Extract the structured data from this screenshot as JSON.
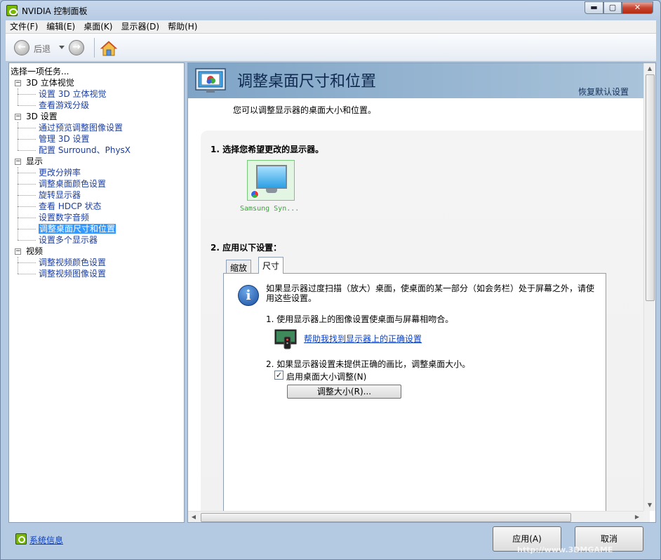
{
  "window": {
    "title": "NVIDIA 控制面板",
    "min_glyph": "▬",
    "max_glyph": "▢",
    "close_glyph": "✕"
  },
  "menu": [
    "文件(F)",
    "编辑(E)",
    "桌面(K)",
    "显示器(D)",
    "帮助(H)"
  ],
  "toolbar": {
    "back_label": "后退"
  },
  "left_panel": {
    "header": "选择一项任务...",
    "categories": [
      {
        "label": "3D 立体视觉",
        "items": [
          "设置 3D 立体视觉",
          "查看游戏分级"
        ]
      },
      {
        "label": "3D 设置",
        "items": [
          "通过预览调整图像设置",
          "管理 3D 设置",
          "配置 Surround、PhysX"
        ]
      },
      {
        "label": "显示",
        "items": [
          "更改分辨率",
          "调整桌面颜色设置",
          "旋转显示器",
          "查看 HDCP 状态",
          "设置数字音频",
          "调整桌面尺寸和位置",
          "设置多个显示器"
        ]
      },
      {
        "label": "视频",
        "items": [
          "调整视频颜色设置",
          "调整视频图像设置"
        ]
      }
    ],
    "selected_item": "调整桌面尺寸和位置"
  },
  "main": {
    "title": "调整桌面尺寸和位置",
    "restore_defaults": "恢复默认设置",
    "subtitle": "您可以调整显示器的桌面大小和位置。",
    "step1": "1.  选择您希望更改的显示器。",
    "monitor_label": "Samsung Syn...",
    "step2": "2.  应用以下设置：",
    "tabs": [
      "缩放",
      "尺寸"
    ],
    "active_tab": "尺寸",
    "info_text": "如果显示器过度扫描（放大）桌面，使桌面的某一部分（如会务栏）处于屏幕之外，请使用这些设置。",
    "sub1": "1.  使用显示器上的图像设置使桌面与屏幕相吻合。",
    "help_link": "帮助我找到显示器上的正确设置",
    "sub2": "2.  如果显示器设置未提供正确的画比，调整桌面大小。",
    "checkbox_label": "启用桌面大小调整(N)",
    "checkbox_checked": true,
    "checkbox_mark": "✓",
    "resize_button": "调整大小(R)..."
  },
  "footer": {
    "system_info": "系统信息",
    "apply": "应用(A)",
    "cancel": "取消"
  },
  "watermark": "http://www.3DMGAME"
}
